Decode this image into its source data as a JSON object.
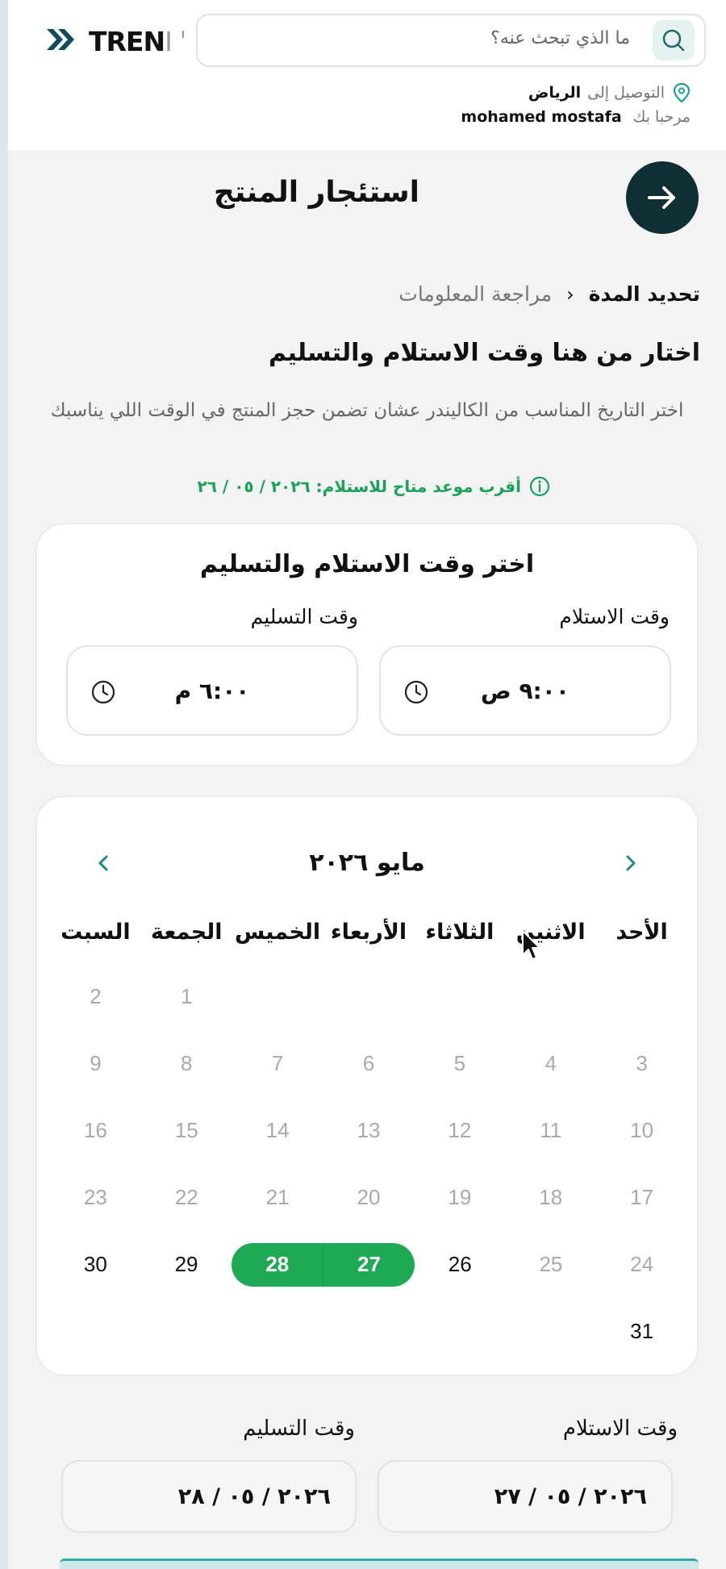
{
  "header": {
    "logo_mark": "»",
    "logo_main": "TREN",
    "logo_fade": "I ˈ",
    "search_placeholder": "ما الذي تبحث عنه؟",
    "delivery_prefix": "التوصيل إلى",
    "delivery_city": "الرياض",
    "greeting_prefix": "مرحبا بك",
    "user_name": "mohamed mostafa"
  },
  "page": {
    "title": "استئجار المنتج",
    "breadcrumb": {
      "active": "تحديد المدة",
      "separator": "‹",
      "next": "مراجعة المعلومات"
    },
    "section_heading": "اختار من هنا وقت الاستلام والتسليم",
    "section_desc": "اختر التاريخ المناسب من الكاليندر عشان تضمن حجز المنتج في الوقت اللي يناسبك",
    "earliest": "أقرب موعد متاح للاستلام: ٢٠٢٦ / ٠٥ / ٢٦"
  },
  "time_card": {
    "title": "اختر وقت الاستلام والتسليم",
    "pickup_label": "وقت الاستلام",
    "pickup_time": "٩:٠٠ ص",
    "return_label": "وقت التسليم",
    "return_time": "٦:٠٠ م"
  },
  "calendar": {
    "month": "مايو ٢٠٢٦",
    "weekdays": [
      "الأحد",
      "الاثنين",
      "الثلاثاء",
      "الأربعاء",
      "الخميس",
      "الجمعة",
      "السبت"
    ],
    "weeks": [
      [
        "",
        "",
        "",
        "",
        "",
        "1",
        "2"
      ],
      [
        "3",
        "4",
        "5",
        "6",
        "7",
        "8",
        "9"
      ],
      [
        "10",
        "11",
        "12",
        "13",
        "14",
        "15",
        "16"
      ],
      [
        "17",
        "18",
        "19",
        "20",
        "21",
        "22",
        "23"
      ],
      [
        "24",
        "25",
        "26",
        "27",
        "28",
        "29",
        "30"
      ],
      [
        "31",
        "",
        "",
        "",
        "",
        "",
        ""
      ]
    ],
    "available": [
      "26",
      "27",
      "28",
      "29",
      "30",
      "31"
    ],
    "selected_start": "27",
    "selected_end": "28"
  },
  "bottom": {
    "pickup_label": "وقت الاستلام",
    "pickup_date": "٢٠٢٦ / ٠٥ / ٢٧",
    "return_label": "وقت التسليم",
    "return_date": "٢٠٢٦ / ٠٥ / ٢٨"
  },
  "colors": {
    "accent_green": "#1eaa55",
    "dark_teal": "#0e2f34",
    "logo_teal": "#0f4d5c"
  },
  "icons": [
    "search-icon",
    "location-pin-icon",
    "arrow-right-icon",
    "chevron-left-icon",
    "info-icon",
    "clock-icon",
    "chevron-right-icon",
    "mouse-cursor-icon"
  ]
}
